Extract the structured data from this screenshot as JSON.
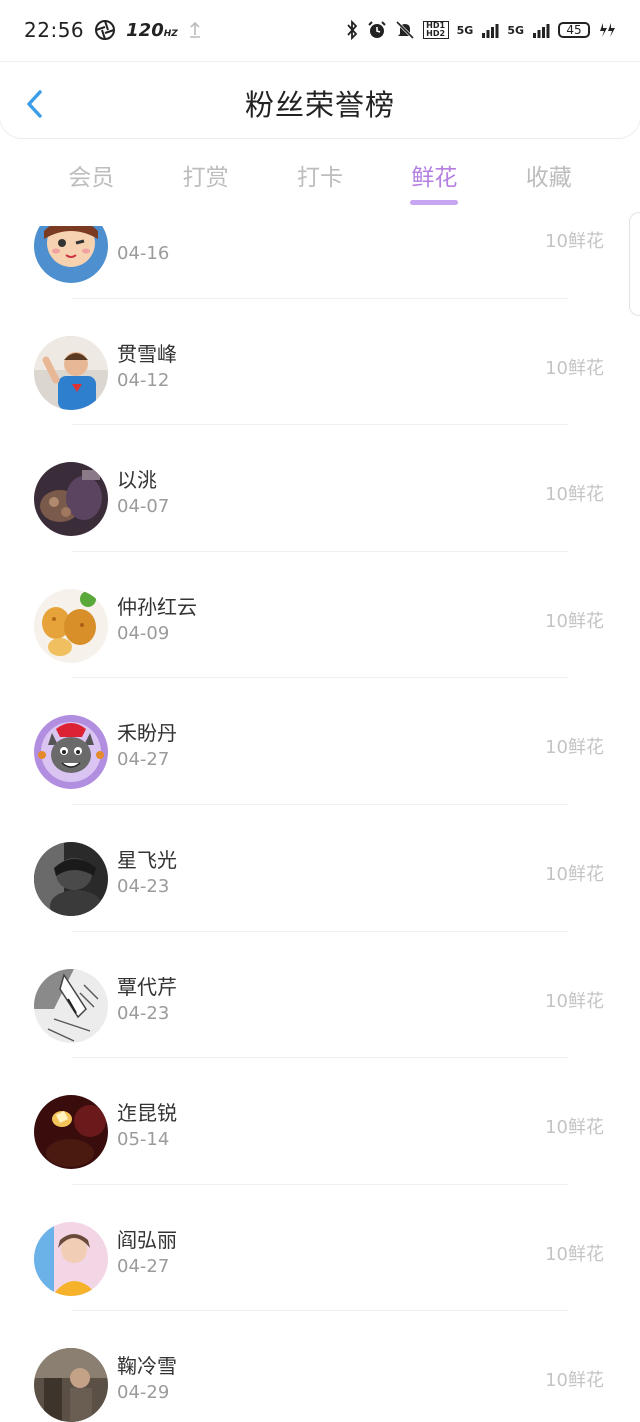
{
  "status_bar": {
    "time": "22:56",
    "refresh_rate": "120",
    "refresh_unit": "HZ",
    "hd_tag": "HD1 HD2",
    "network": "5G",
    "battery": "45"
  },
  "header": {
    "title": "粉丝荣誉榜"
  },
  "tabs": [
    {
      "label": "会员",
      "active": false
    },
    {
      "label": "打赏",
      "active": false
    },
    {
      "label": "打卡",
      "active": false
    },
    {
      "label": "鲜花",
      "active": true
    },
    {
      "label": "收藏",
      "active": false
    }
  ],
  "colors": {
    "accent": "#b47fe0",
    "back_arrow": "#3d9ee8",
    "muted": "#c4c4c4"
  },
  "fans": [
    {
      "name": "",
      "date": "04-16",
      "amount": "10鲜花",
      "avatar": "cartoon-girl-avatar"
    },
    {
      "name": "贯雪峰",
      "date": "04-12",
      "amount": "10鲜花",
      "avatar": "child-photo-avatar"
    },
    {
      "name": "以洮",
      "date": "04-07",
      "amount": "10鲜花",
      "avatar": "dark-photo-avatar"
    },
    {
      "name": "仲孙红云",
      "date": "04-09",
      "amount": "10鲜花",
      "avatar": "food-avatar"
    },
    {
      "name": "禾盼丹",
      "date": "04-27",
      "amount": "10鲜花",
      "avatar": "cartoon-wolf-avatar"
    },
    {
      "name": "星飞光",
      "date": "04-23",
      "amount": "10鲜花",
      "avatar": "bw-portrait-avatar"
    },
    {
      "name": "覃代芹",
      "date": "04-23",
      "amount": "10鲜花",
      "avatar": "sketch-avatar"
    },
    {
      "name": "迮昆锐",
      "date": "05-14",
      "amount": "10鲜花",
      "avatar": "night-photo-avatar"
    },
    {
      "name": "阎弘丽",
      "date": "04-27",
      "amount": "10鲜花",
      "avatar": "girl-photo-avatar"
    },
    {
      "name": "鞠冷雪",
      "date": "04-29",
      "amount": "10鲜花",
      "avatar": "street-photo-avatar"
    }
  ]
}
